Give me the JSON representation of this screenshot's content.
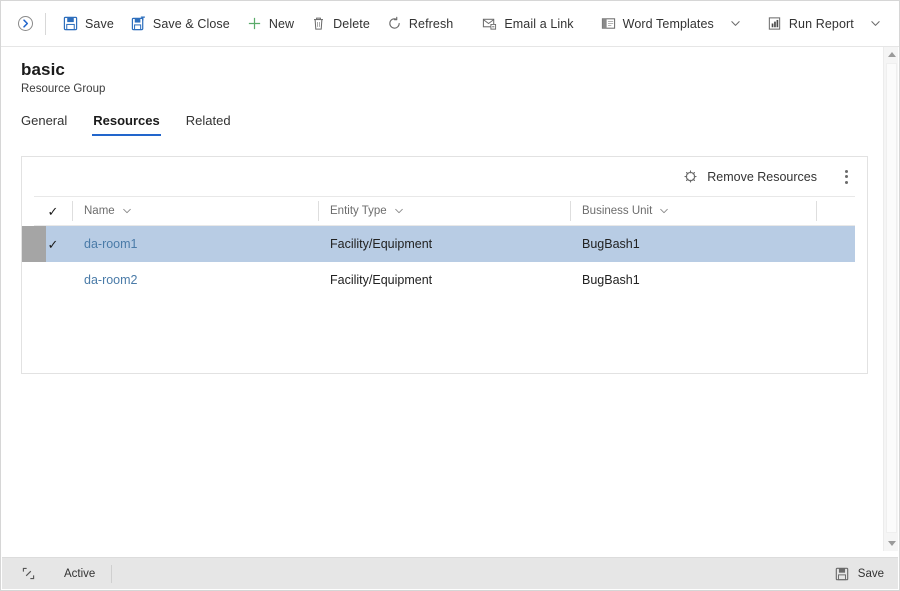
{
  "commandbar": {
    "expand_icon": "chevron-circle-icon",
    "buttons": [
      {
        "label": "Save",
        "icon": "save-icon",
        "has_caret": false
      },
      {
        "label": "Save & Close",
        "icon": "save-and-close-icon",
        "has_caret": false
      },
      {
        "label": "New",
        "icon": "plus-icon",
        "has_caret": false
      },
      {
        "label": "Delete",
        "icon": "trash-icon",
        "has_caret": false
      },
      {
        "label": "Refresh",
        "icon": "refresh-icon",
        "has_caret": false
      },
      {
        "label": "Email a Link",
        "icon": "email-link-icon",
        "has_caret": false
      },
      {
        "label": "Word Templates",
        "icon": "word-templates-icon",
        "has_caret": true
      },
      {
        "label": "Run Report",
        "icon": "run-report-icon",
        "has_caret": true
      }
    ]
  },
  "header": {
    "title": "basic",
    "subtitle": "Resource Group"
  },
  "tabs": [
    {
      "label": "General",
      "active": false
    },
    {
      "label": "Resources",
      "active": true
    },
    {
      "label": "Related",
      "active": false
    }
  ],
  "grid": {
    "commands": {
      "remove_resources_label": "Remove Resources",
      "remove_resources_icon": "remove-resources-icon",
      "overflow_icon": "more-vertical-icon"
    },
    "columns": [
      {
        "label": "Name",
        "sort_icon": "chevron-down-icon"
      },
      {
        "label": "Entity Type",
        "sort_icon": "chevron-down-icon"
      },
      {
        "label": "Business Unit",
        "sort_icon": "chevron-down-icon"
      }
    ],
    "select_all_icon": "checkmark-icon",
    "rows": [
      {
        "selected": true,
        "check": "✓",
        "name": "da-room1",
        "entity_type": "Facility/Equipment",
        "business_unit": "BugBash1"
      },
      {
        "selected": false,
        "check": "",
        "name": "da-room2",
        "entity_type": "Facility/Equipment",
        "business_unit": "BugBash1"
      }
    ]
  },
  "statusbar": {
    "resize_icon": "resize-grip-icon",
    "status": "Active",
    "save_label": "Save",
    "save_icon": "save-icon"
  },
  "scrollbar": {
    "up_icon": "scroll-up-arrow-icon",
    "down_icon": "scroll-down-arrow-icon"
  },
  "colors": {
    "accent": "#2266cc",
    "link": "#4a7ba8",
    "row_selected": "#b8cce4",
    "save_icon": "#2e6fbd",
    "new_icon": "#5aab6a",
    "statusbar_bg": "#e6e6e6"
  }
}
